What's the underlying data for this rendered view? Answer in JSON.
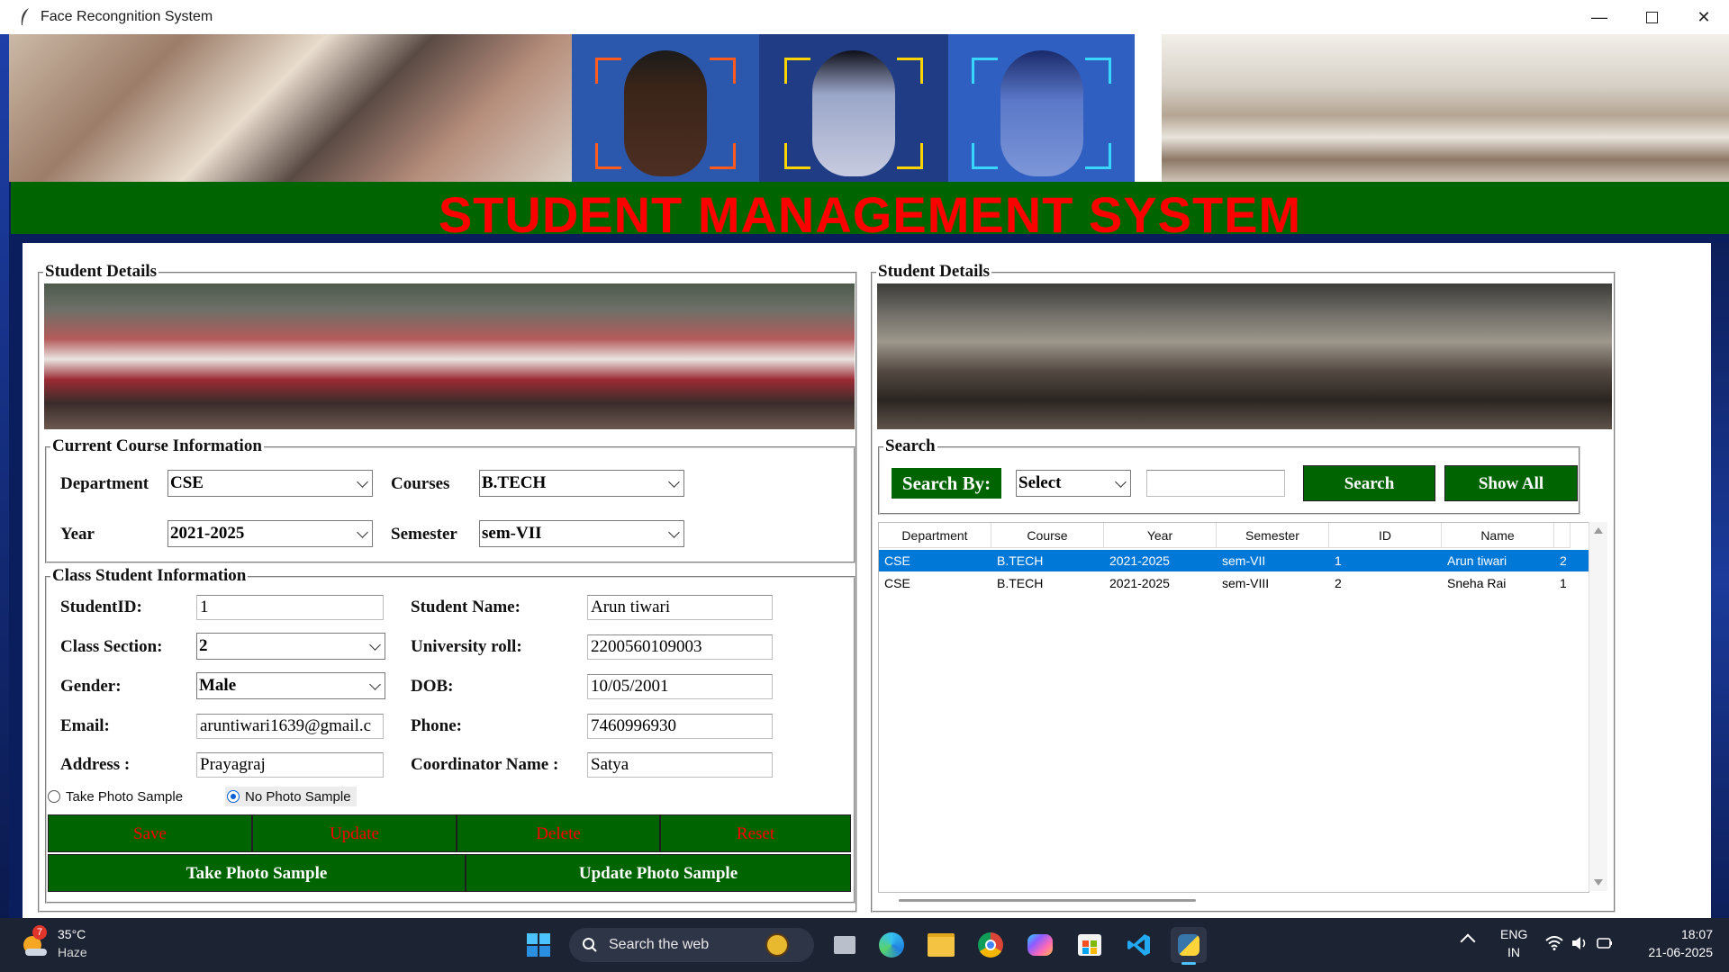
{
  "window": {
    "title": "Face Recongnition System"
  },
  "banner": {
    "title": "STUDENT MANAGEMENT SYSTEM"
  },
  "left_panel": {
    "title": "Student Details",
    "course_info": {
      "title": "Current Course Information",
      "department_label": "Department",
      "department_value": "CSE",
      "courses_label": "Courses",
      "courses_value": "B.TECH",
      "year_label": "Year",
      "year_value": "2021-2025",
      "semester_label": "Semester",
      "semester_value": "sem-VII"
    },
    "class_info": {
      "title": "Class Student Information",
      "student_id_label": "StudentID:",
      "student_id_value": "1",
      "student_name_label": "Student Name:",
      "student_name_value": "Arun tiwari",
      "class_section_label": "Class Section:",
      "class_section_value": "2",
      "university_roll_label": "University roll:",
      "university_roll_value": "2200560109003",
      "gender_label": "Gender:",
      "gender_value": "Male",
      "dob_label": "DOB:",
      "dob_value": "10/05/2001",
      "email_label": "Email:",
      "email_value": "aruntiwari1639@gmail.c",
      "phone_label": "Phone:",
      "phone_value": "7460996930",
      "address_label": "Address :",
      "address_value": "Prayagraj",
      "coordinator_label": "Coordinator Name :",
      "coordinator_value": "Satya",
      "radio_take": "Take Photo Sample",
      "radio_no": "No Photo Sample",
      "radio_selected": "No Photo Sample"
    },
    "buttons": {
      "save": "Save",
      "update": "Update",
      "delete": "Delete",
      "reset": "Reset",
      "take_photo": "Take Photo Sample",
      "update_photo": "Update Photo Sample"
    }
  },
  "right_panel": {
    "title": "Student Details",
    "search": {
      "title": "Search",
      "search_by_label": "Search By:",
      "select_value": "Select",
      "search_text": "",
      "search_button": "Search",
      "show_all_button": "Show All"
    },
    "table": {
      "columns": [
        "Department",
        "Course",
        "Year",
        "Semester",
        "ID",
        "Name",
        ""
      ],
      "rows": [
        [
          "CSE",
          "B.TECH",
          "2021-2025",
          "sem-VII",
          "1",
          "Arun tiwari",
          "2"
        ],
        [
          "CSE",
          "B.TECH",
          "2021-2025",
          "sem-VIII",
          "2",
          "Sneha Rai",
          "1"
        ]
      ],
      "selected_row": 0
    }
  },
  "taskbar": {
    "weather_temp": "35°C",
    "weather_desc": "Haze",
    "weather_badge": "7",
    "search_placeholder": "Search the web",
    "lang_line1": "ENG",
    "lang_line2": "IN",
    "time": "18:07",
    "date": "21-06-2025"
  },
  "colors": {
    "banner_bg": "#006400",
    "banner_text": "#ff0000",
    "button_bg": "#006400",
    "action_text": "#ff0000",
    "selection": "#0078d7"
  }
}
